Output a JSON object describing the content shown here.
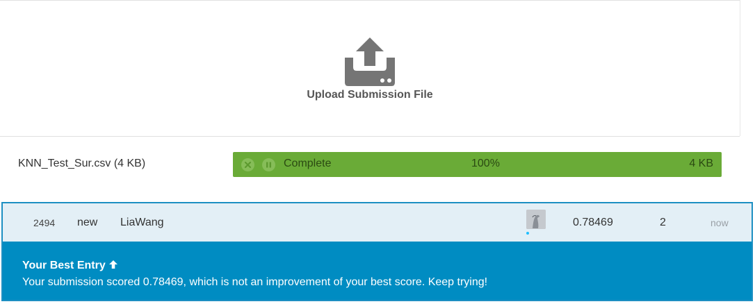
{
  "upload": {
    "label": "Upload Submission File",
    "icon": "upload-icon",
    "icon_color": "#757575"
  },
  "file": {
    "name_with_size": "KNN_Test_Sur.csv (4 KB)",
    "status": "Complete",
    "percent_text": "100%",
    "progress": 1.0,
    "size": "4 KB",
    "controls": [
      "cancel-icon",
      "pause-icon"
    ],
    "bar_color": "#6aab37"
  },
  "leaderboard_row": {
    "rank": "2494",
    "change": "new",
    "team": "LiaWang",
    "avatar": "avatar-image",
    "score": "0.78469",
    "entries": "2",
    "last": "now"
  },
  "banner": {
    "title": "Your Best Entry",
    "icon": "arrow-up-icon",
    "message": "Your submission scored 0.78469, which is not an improvement of your best score. Keep trying!",
    "color": "#008cc2"
  }
}
